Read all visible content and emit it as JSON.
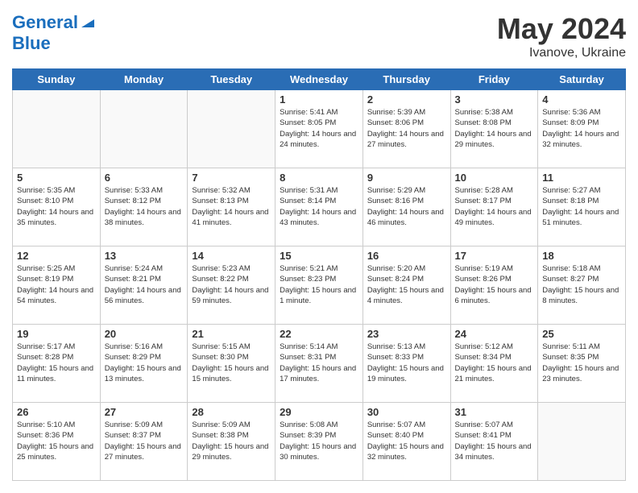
{
  "header": {
    "logo_line1_general": "General",
    "logo_line2": "Blue",
    "title": "May 2024",
    "location": "Ivanove, Ukraine"
  },
  "days_of_week": [
    "Sunday",
    "Monday",
    "Tuesday",
    "Wednesday",
    "Thursday",
    "Friday",
    "Saturday"
  ],
  "weeks": [
    [
      {
        "day": "",
        "sunrise": "",
        "sunset": "",
        "daylight": ""
      },
      {
        "day": "",
        "sunrise": "",
        "sunset": "",
        "daylight": ""
      },
      {
        "day": "",
        "sunrise": "",
        "sunset": "",
        "daylight": ""
      },
      {
        "day": "1",
        "sunrise": "Sunrise: 5:41 AM",
        "sunset": "Sunset: 8:05 PM",
        "daylight": "Daylight: 14 hours and 24 minutes."
      },
      {
        "day": "2",
        "sunrise": "Sunrise: 5:39 AM",
        "sunset": "Sunset: 8:06 PM",
        "daylight": "Daylight: 14 hours and 27 minutes."
      },
      {
        "day": "3",
        "sunrise": "Sunrise: 5:38 AM",
        "sunset": "Sunset: 8:08 PM",
        "daylight": "Daylight: 14 hours and 29 minutes."
      },
      {
        "day": "4",
        "sunrise": "Sunrise: 5:36 AM",
        "sunset": "Sunset: 8:09 PM",
        "daylight": "Daylight: 14 hours and 32 minutes."
      }
    ],
    [
      {
        "day": "5",
        "sunrise": "Sunrise: 5:35 AM",
        "sunset": "Sunset: 8:10 PM",
        "daylight": "Daylight: 14 hours and 35 minutes."
      },
      {
        "day": "6",
        "sunrise": "Sunrise: 5:33 AM",
        "sunset": "Sunset: 8:12 PM",
        "daylight": "Daylight: 14 hours and 38 minutes."
      },
      {
        "day": "7",
        "sunrise": "Sunrise: 5:32 AM",
        "sunset": "Sunset: 8:13 PM",
        "daylight": "Daylight: 14 hours and 41 minutes."
      },
      {
        "day": "8",
        "sunrise": "Sunrise: 5:31 AM",
        "sunset": "Sunset: 8:14 PM",
        "daylight": "Daylight: 14 hours and 43 minutes."
      },
      {
        "day": "9",
        "sunrise": "Sunrise: 5:29 AM",
        "sunset": "Sunset: 8:16 PM",
        "daylight": "Daylight: 14 hours and 46 minutes."
      },
      {
        "day": "10",
        "sunrise": "Sunrise: 5:28 AM",
        "sunset": "Sunset: 8:17 PM",
        "daylight": "Daylight: 14 hours and 49 minutes."
      },
      {
        "day": "11",
        "sunrise": "Sunrise: 5:27 AM",
        "sunset": "Sunset: 8:18 PM",
        "daylight": "Daylight: 14 hours and 51 minutes."
      }
    ],
    [
      {
        "day": "12",
        "sunrise": "Sunrise: 5:25 AM",
        "sunset": "Sunset: 8:19 PM",
        "daylight": "Daylight: 14 hours and 54 minutes."
      },
      {
        "day": "13",
        "sunrise": "Sunrise: 5:24 AM",
        "sunset": "Sunset: 8:21 PM",
        "daylight": "Daylight: 14 hours and 56 minutes."
      },
      {
        "day": "14",
        "sunrise": "Sunrise: 5:23 AM",
        "sunset": "Sunset: 8:22 PM",
        "daylight": "Daylight: 14 hours and 59 minutes."
      },
      {
        "day": "15",
        "sunrise": "Sunrise: 5:21 AM",
        "sunset": "Sunset: 8:23 PM",
        "daylight": "Daylight: 15 hours and 1 minute."
      },
      {
        "day": "16",
        "sunrise": "Sunrise: 5:20 AM",
        "sunset": "Sunset: 8:24 PM",
        "daylight": "Daylight: 15 hours and 4 minutes."
      },
      {
        "day": "17",
        "sunrise": "Sunrise: 5:19 AM",
        "sunset": "Sunset: 8:26 PM",
        "daylight": "Daylight: 15 hours and 6 minutes."
      },
      {
        "day": "18",
        "sunrise": "Sunrise: 5:18 AM",
        "sunset": "Sunset: 8:27 PM",
        "daylight": "Daylight: 15 hours and 8 minutes."
      }
    ],
    [
      {
        "day": "19",
        "sunrise": "Sunrise: 5:17 AM",
        "sunset": "Sunset: 8:28 PM",
        "daylight": "Daylight: 15 hours and 11 minutes."
      },
      {
        "day": "20",
        "sunrise": "Sunrise: 5:16 AM",
        "sunset": "Sunset: 8:29 PM",
        "daylight": "Daylight: 15 hours and 13 minutes."
      },
      {
        "day": "21",
        "sunrise": "Sunrise: 5:15 AM",
        "sunset": "Sunset: 8:30 PM",
        "daylight": "Daylight: 15 hours and 15 minutes."
      },
      {
        "day": "22",
        "sunrise": "Sunrise: 5:14 AM",
        "sunset": "Sunset: 8:31 PM",
        "daylight": "Daylight: 15 hours and 17 minutes."
      },
      {
        "day": "23",
        "sunrise": "Sunrise: 5:13 AM",
        "sunset": "Sunset: 8:33 PM",
        "daylight": "Daylight: 15 hours and 19 minutes."
      },
      {
        "day": "24",
        "sunrise": "Sunrise: 5:12 AM",
        "sunset": "Sunset: 8:34 PM",
        "daylight": "Daylight: 15 hours and 21 minutes."
      },
      {
        "day": "25",
        "sunrise": "Sunrise: 5:11 AM",
        "sunset": "Sunset: 8:35 PM",
        "daylight": "Daylight: 15 hours and 23 minutes."
      }
    ],
    [
      {
        "day": "26",
        "sunrise": "Sunrise: 5:10 AM",
        "sunset": "Sunset: 8:36 PM",
        "daylight": "Daylight: 15 hours and 25 minutes."
      },
      {
        "day": "27",
        "sunrise": "Sunrise: 5:09 AM",
        "sunset": "Sunset: 8:37 PM",
        "daylight": "Daylight: 15 hours and 27 minutes."
      },
      {
        "day": "28",
        "sunrise": "Sunrise: 5:09 AM",
        "sunset": "Sunset: 8:38 PM",
        "daylight": "Daylight: 15 hours and 29 minutes."
      },
      {
        "day": "29",
        "sunrise": "Sunrise: 5:08 AM",
        "sunset": "Sunset: 8:39 PM",
        "daylight": "Daylight: 15 hours and 30 minutes."
      },
      {
        "day": "30",
        "sunrise": "Sunrise: 5:07 AM",
        "sunset": "Sunset: 8:40 PM",
        "daylight": "Daylight: 15 hours and 32 minutes."
      },
      {
        "day": "31",
        "sunrise": "Sunrise: 5:07 AM",
        "sunset": "Sunset: 8:41 PM",
        "daylight": "Daylight: 15 hours and 34 minutes."
      },
      {
        "day": "",
        "sunrise": "",
        "sunset": "",
        "daylight": ""
      }
    ]
  ]
}
